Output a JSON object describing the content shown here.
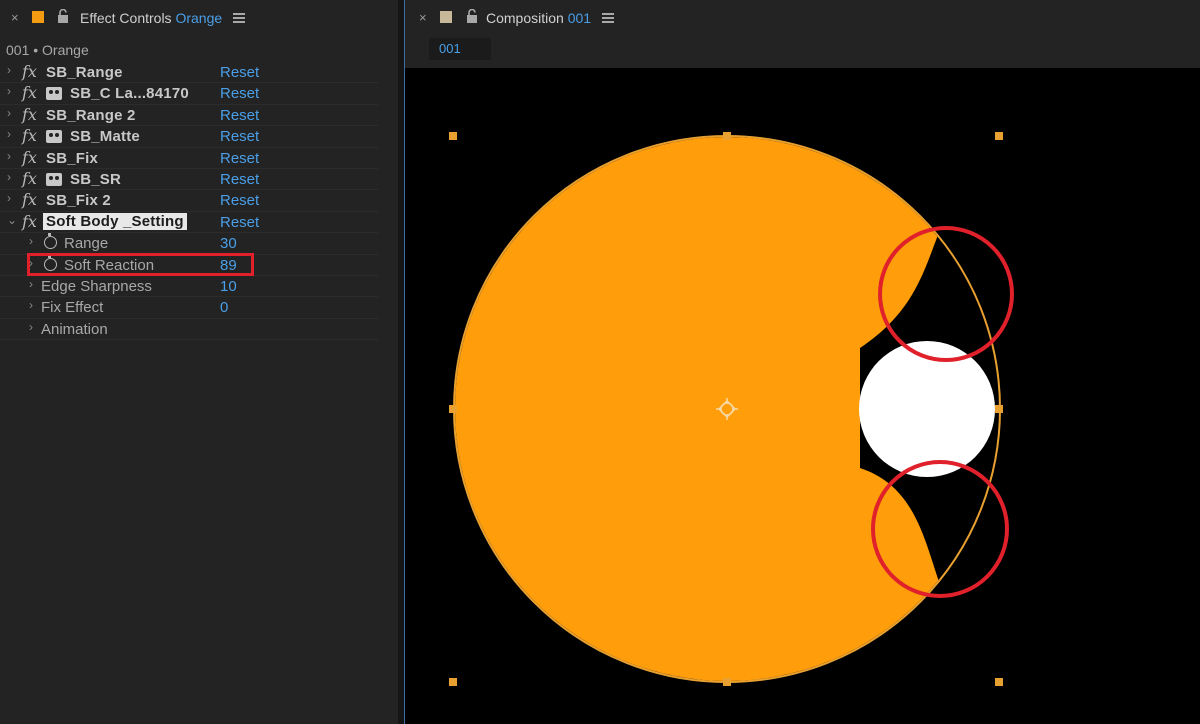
{
  "effect_controls": {
    "tab": {
      "close": "×",
      "label": "Effect Controls",
      "layer": "Orange"
    },
    "layer_path": "001 • Orange",
    "effects": [
      {
        "name": "SB_Range",
        "reset": "Reset",
        "icon": "fx-icon"
      },
      {
        "name": "SB_C La...84170",
        "reset": "Reset",
        "icon": "camera-icon"
      },
      {
        "name": "SB_Range 2",
        "reset": "Reset",
        "icon": "fx-icon"
      },
      {
        "name": "SB_Matte",
        "reset": "Reset",
        "icon": "camera-icon"
      },
      {
        "name": "SB_Fix",
        "reset": "Reset",
        "icon": "fx-icon"
      },
      {
        "name": "SB_SR",
        "reset": "Reset",
        "icon": "camera-icon"
      },
      {
        "name": "SB_Fix 2",
        "reset": "Reset",
        "icon": "fx-icon"
      },
      {
        "name": "Soft Body _Setting",
        "reset": "Reset",
        "icon": "fx-icon",
        "expanded": true
      }
    ],
    "parameters": [
      {
        "name": "Range",
        "value": "30",
        "stopwatch": true
      },
      {
        "name": "Soft Reaction",
        "value": "89",
        "stopwatch": true,
        "highlighted": true
      },
      {
        "name": "Edge Sharpness",
        "value": "10",
        "stopwatch": false
      },
      {
        "name": "Fix Effect",
        "value": "0",
        "stopwatch": false
      },
      {
        "name": "Animation",
        "value": "",
        "stopwatch": false
      }
    ]
  },
  "composition": {
    "tab": {
      "close": "×",
      "label": "Composition",
      "name": "001"
    },
    "comp_tab": "001",
    "colors": {
      "orange": "#ff9d0a",
      "white": "#ffffff",
      "annotation": "#e0202a",
      "handle": "#e8a030"
    }
  }
}
